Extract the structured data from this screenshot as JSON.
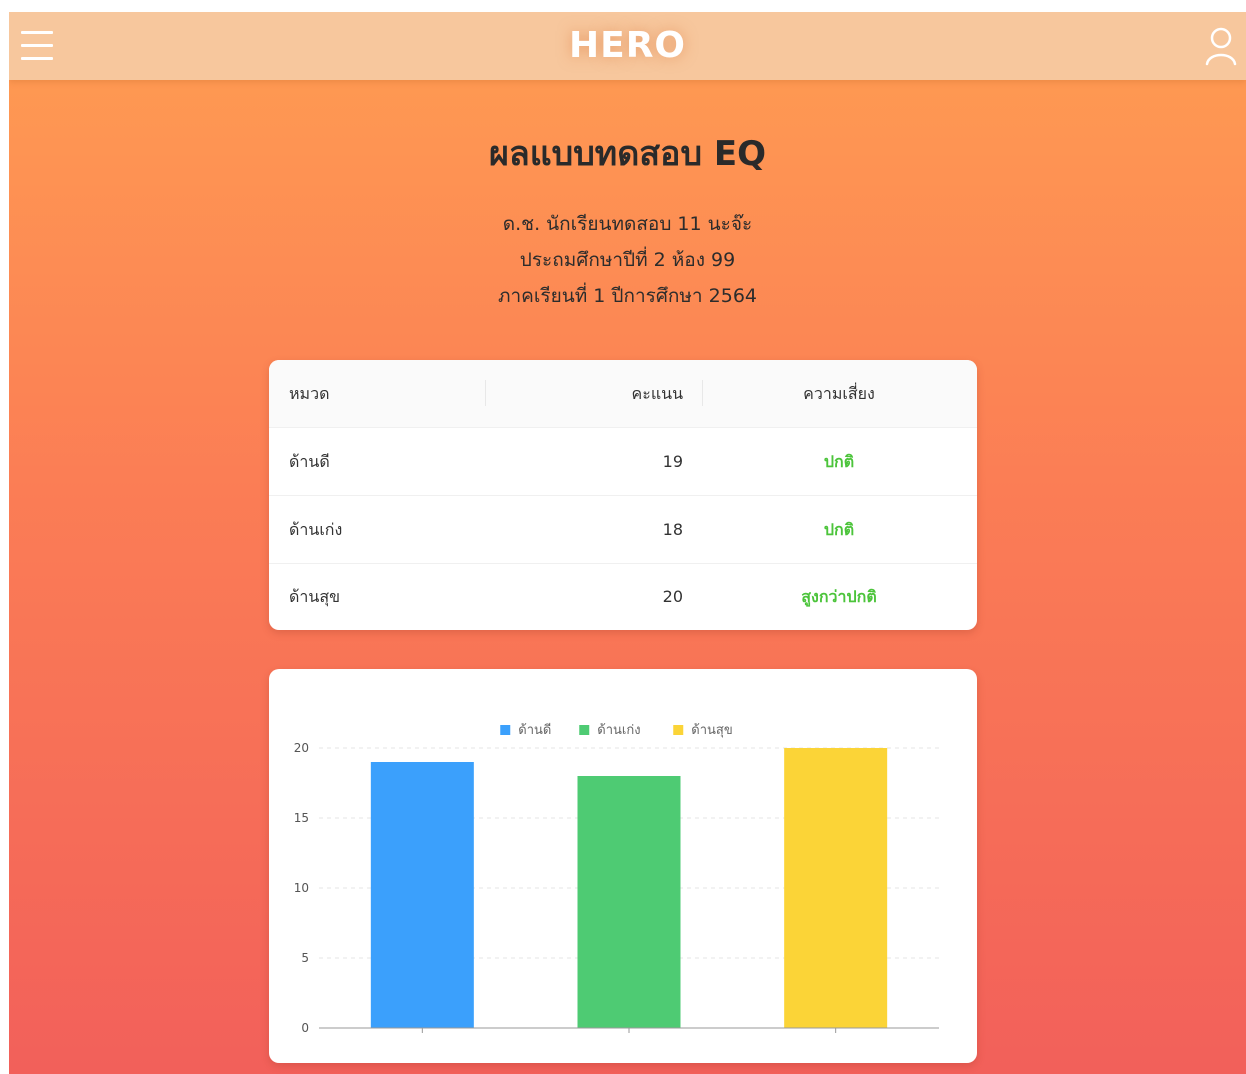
{
  "header": {
    "brand": "HERO",
    "menu_icon": "hamburger-menu-icon",
    "user_icon": "user-profile-icon",
    "bar_color": "#f7c79d"
  },
  "title": "ผลแบบทดสอบ EQ",
  "student": {
    "name": "ด.ช. นักเรียนทดสอบ 11 นะจ๊ะ",
    "class": "ประถมศึกษาปีที่ 2 ห้อง 99",
    "term": "ภาคเรียนที่ 1 ปีการศึกษา 2564"
  },
  "table": {
    "headers": [
      "หมวด",
      "คะแนน",
      "ความเสี่ยง"
    ],
    "rows": [
      {
        "category": "ด้านดี",
        "score": "19",
        "risk": "ปกติ"
      },
      {
        "category": "ด้านเก่ง",
        "score": "18",
        "risk": "ปกติ"
      },
      {
        "category": "ด้านสุข",
        "score": "20",
        "risk": "สูงกว่าปกติ"
      }
    ],
    "risk_color": "#4cc43b"
  },
  "chart_data": {
    "type": "bar",
    "categories": [
      "",
      "",
      ""
    ],
    "series": [
      {
        "name": "ด้านดี",
        "values": [
          19
        ],
        "color": "#3ba0fc"
      },
      {
        "name": "ด้านเก่ง",
        "values": [
          18
        ],
        "color": "#4ecb73"
      },
      {
        "name": "ด้านสุข",
        "values": [
          20
        ],
        "color": "#fbd437"
      }
    ],
    "ylim": [
      0,
      20
    ],
    "yticks": [
      0,
      5,
      10,
      15,
      20
    ],
    "grid": true,
    "legend": "top-center"
  }
}
